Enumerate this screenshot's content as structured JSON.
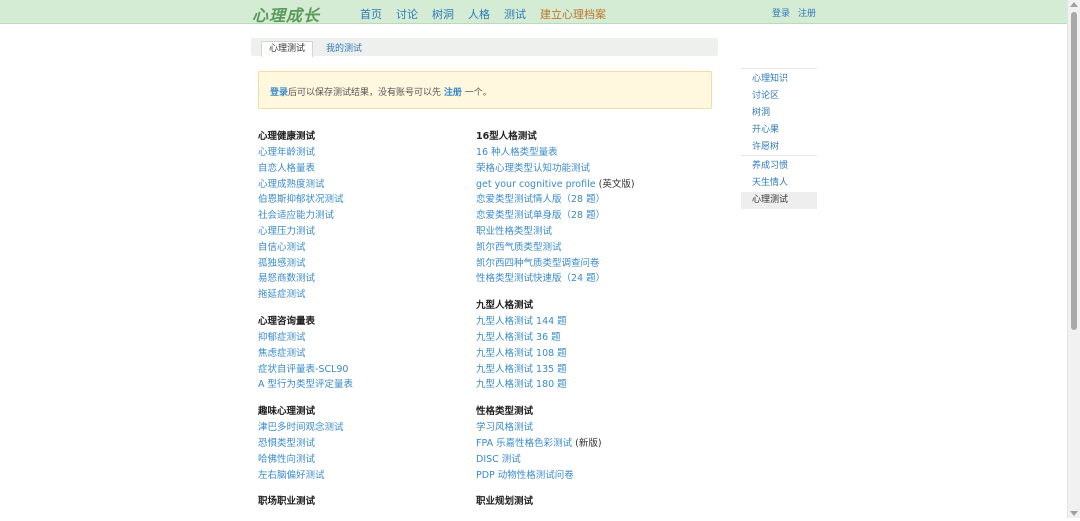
{
  "header": {
    "logo": "心理成长",
    "nav": [
      {
        "label": "首页",
        "emph": false
      },
      {
        "label": "讨论",
        "emph": false
      },
      {
        "label": "树洞",
        "emph": false
      },
      {
        "label": "人格",
        "emph": false
      },
      {
        "label": "测试",
        "emph": false
      },
      {
        "label": "建立心理档案",
        "emph": true
      }
    ],
    "login": "登录",
    "register": "注册"
  },
  "tabs": {
    "active": "心理测试",
    "other": "我的测试"
  },
  "notice": {
    "login": "登录",
    "text1": "后可以保存测试结果，没有账号可以先",
    "register": "注册",
    "text2": "一个。"
  },
  "left_column": [
    {
      "title": "心理健康测试",
      "items": [
        {
          "label": "心理年龄测试"
        },
        {
          "label": "自恋人格量表"
        },
        {
          "label": "心理成熟度测试"
        },
        {
          "label": "伯恩斯抑郁状况测试"
        },
        {
          "label": "社会适应能力测试"
        },
        {
          "label": "心理压力测试"
        },
        {
          "label": "自信心测试"
        },
        {
          "label": "孤独感测试"
        },
        {
          "label": "易怒商数测试"
        },
        {
          "label": "拖延症测试"
        }
      ]
    },
    {
      "title": "心理咨询量表",
      "items": [
        {
          "label": "抑郁症测试"
        },
        {
          "label": "焦虑症测试"
        },
        {
          "label": "症状自评量表-SCL90"
        },
        {
          "label": "A 型行为类型评定量表"
        }
      ]
    },
    {
      "title": "趣味心理测试",
      "items": [
        {
          "label": "津巴多时间观念测试"
        },
        {
          "label": "恐惧类型测试"
        },
        {
          "label": "哈佛性向测试"
        },
        {
          "label": "左右脑偏好测试"
        }
      ]
    },
    {
      "title": "职场职业测试",
      "items": []
    }
  ],
  "right_column": [
    {
      "title": "16型人格测试",
      "items": [
        {
          "label": "16 种人格类型量表"
        },
        {
          "label": "荣格心理类型认知功能测试"
        },
        {
          "label": "get your cognitive profile",
          "note": " (英文版)"
        },
        {
          "label": "恋爱类型测试情人版（28 题）"
        },
        {
          "label": "恋爱类型测试单身版（28 题）"
        },
        {
          "label": "职业性格类型测试"
        },
        {
          "label": "凯尔西气质类型测试"
        },
        {
          "label": "凯尔西四种气质类型调查问卷"
        },
        {
          "label": "性格类型测试快速版（24 题）"
        }
      ]
    },
    {
      "title": "九型人格测试",
      "items": [
        {
          "label": "九型人格测试 144 题"
        },
        {
          "label": "九型人格测试 36 题"
        },
        {
          "label": "九型人格测试 108 题"
        },
        {
          "label": "九型人格测试 135 题"
        },
        {
          "label": "九型人格测试 180 题"
        }
      ]
    },
    {
      "title": "性格类型测试",
      "items": [
        {
          "label": "学习风格测试"
        },
        {
          "label": "FPA 乐嘉性格色彩测试",
          "note": " (新版)"
        },
        {
          "label": "DISC 测试"
        },
        {
          "label": "PDP 动物性格测试问卷"
        }
      ]
    },
    {
      "title": "职业规划测试",
      "items": []
    }
  ],
  "sidebar": [
    {
      "label": "心理知识",
      "active": false
    },
    {
      "label": "讨论区",
      "active": false
    },
    {
      "label": "树洞",
      "active": false
    },
    {
      "label": "开心果",
      "active": false
    },
    {
      "label": "许愿树",
      "active": false
    },
    {
      "label": "养成习惯",
      "active": false
    },
    {
      "label": "天生情人",
      "active": false
    },
    {
      "label": "心理测试",
      "active": true
    }
  ]
}
